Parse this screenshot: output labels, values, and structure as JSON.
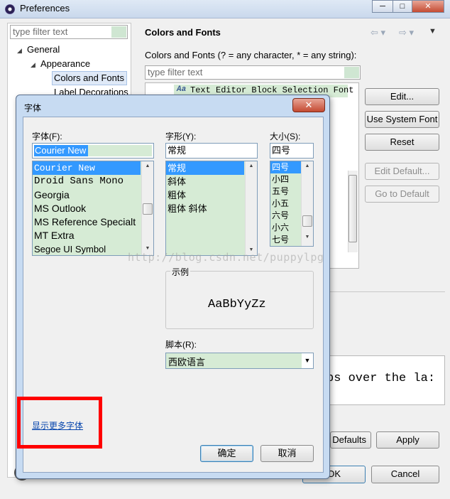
{
  "window": {
    "title": "Preferences",
    "controls": {
      "minimize": "─",
      "maximize": "□",
      "close": "✕"
    }
  },
  "left": {
    "filter_placeholder": "type filter text",
    "tree": [
      {
        "label": "General",
        "expander": "◢"
      },
      {
        "label": "Appearance",
        "expander": "◢"
      },
      {
        "label": "Colors and Fonts"
      },
      {
        "label": "Label Decorations"
      }
    ]
  },
  "right": {
    "title": "Colors and Fonts",
    "description": "Colors and Fonts (? = any character, * = any string):",
    "filter_placeholder": "type filter text",
    "tree_items": [
      "Text Editor Block Selection Font"
    ],
    "tree_icon": "Aa",
    "buttons": {
      "edit": "Edit...",
      "use_system_font": "Use System Font",
      "reset": "Reset",
      "edit_default": "Edit Default...",
      "go_to_default": "Go to Default"
    },
    "preview_text": "ps over the la:",
    "restore_defaults": "Defaults",
    "apply": "Apply"
  },
  "footer": {
    "ok": "OK",
    "cancel": "Cancel"
  },
  "font_dialog": {
    "title": "字体",
    "close": "✕",
    "font_label": "字体(F):",
    "font_value": "Courier New",
    "fonts": [
      "Courier New",
      "Droid Sans Mono",
      "Georgia",
      "MS Outlook",
      "MS Reference Specialt",
      "MT Extra",
      "Segoe UI Symbol"
    ],
    "style_label": "字形(Y):",
    "style_value": "常规",
    "styles": [
      "常规",
      "斜体",
      "粗体",
      "粗体 斜体"
    ],
    "size_label": "大小(S):",
    "size_value": "四号",
    "sizes": [
      "四号",
      "小四",
      "五号",
      "小五",
      "六号",
      "小六",
      "七号"
    ],
    "sample_label": "示例",
    "sample_text": "AaBbYyZz",
    "script_label": "脚本(R):",
    "script_value": "西欧语言",
    "more_fonts": "显示更多字体",
    "ok": "确定",
    "cancel": "取消"
  },
  "watermark": "http://blog.csdn.net/puppylpg",
  "colors": {
    "highlight": "#ff0000",
    "list_bg": "#d6ebd5",
    "selection": "#3399ff"
  }
}
